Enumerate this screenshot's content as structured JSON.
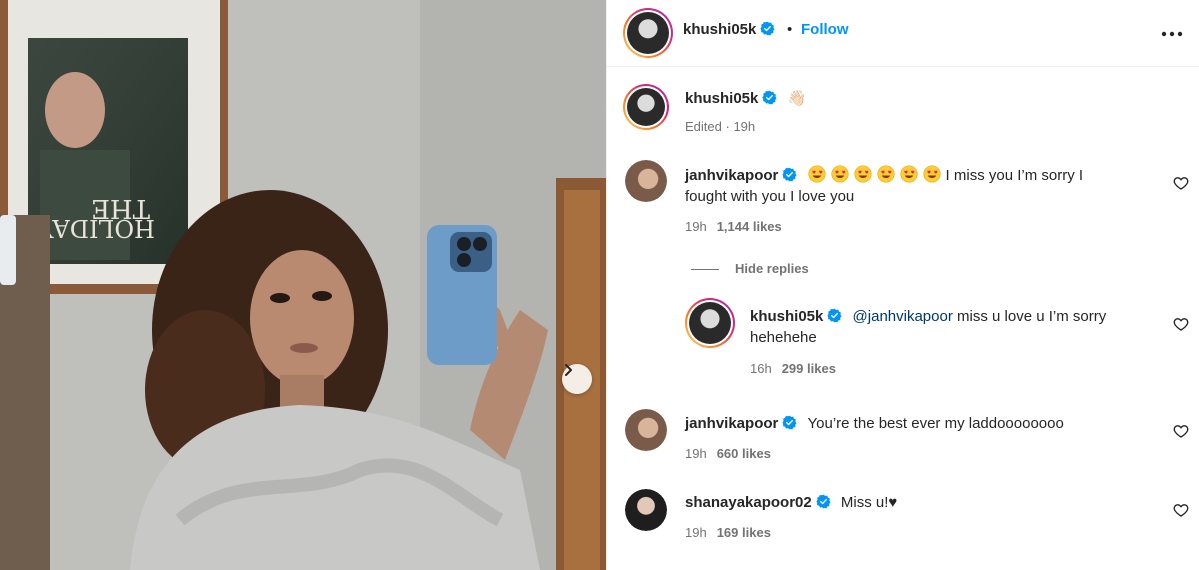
{
  "header": {
    "username": "khushi05k",
    "dot": "•",
    "follow_label": "Follow",
    "more_icon": "more-horizontal-icon"
  },
  "caption": {
    "username": "khushi05k",
    "emoji": "👋🏻",
    "edited_label": "Edited",
    "time": "19h"
  },
  "comments": [
    {
      "username": "janhvikapoor",
      "emoji_count": 6,
      "text": "I miss you I’m sorry I fought with you I love you",
      "time": "19h",
      "likes": "1,144 likes"
    },
    {
      "username": "khushi05k",
      "mention": "@janhvikapoor",
      "text": " miss u love u I’m sorry hehehehe",
      "time": "16h",
      "likes": "299 likes"
    },
    {
      "username": "janhvikapoor",
      "text": "You’re the best ever my laddoooooooo",
      "time": "19h",
      "likes": "660 likes"
    },
    {
      "username": "shanayakapoor02",
      "text": "Miss u!",
      "heart": "♥",
      "time": "19h",
      "likes": "169 likes"
    }
  ],
  "hide_replies_label": "Hide replies",
  "colors": {
    "accent": "#0095f6",
    "verified": "#0095f6",
    "mention": "#00376b",
    "meta": "#737373"
  },
  "icons": [
    "verified-badge-icon",
    "heart-outline-icon",
    "chevron-right-icon",
    "more-horizontal-icon"
  ]
}
